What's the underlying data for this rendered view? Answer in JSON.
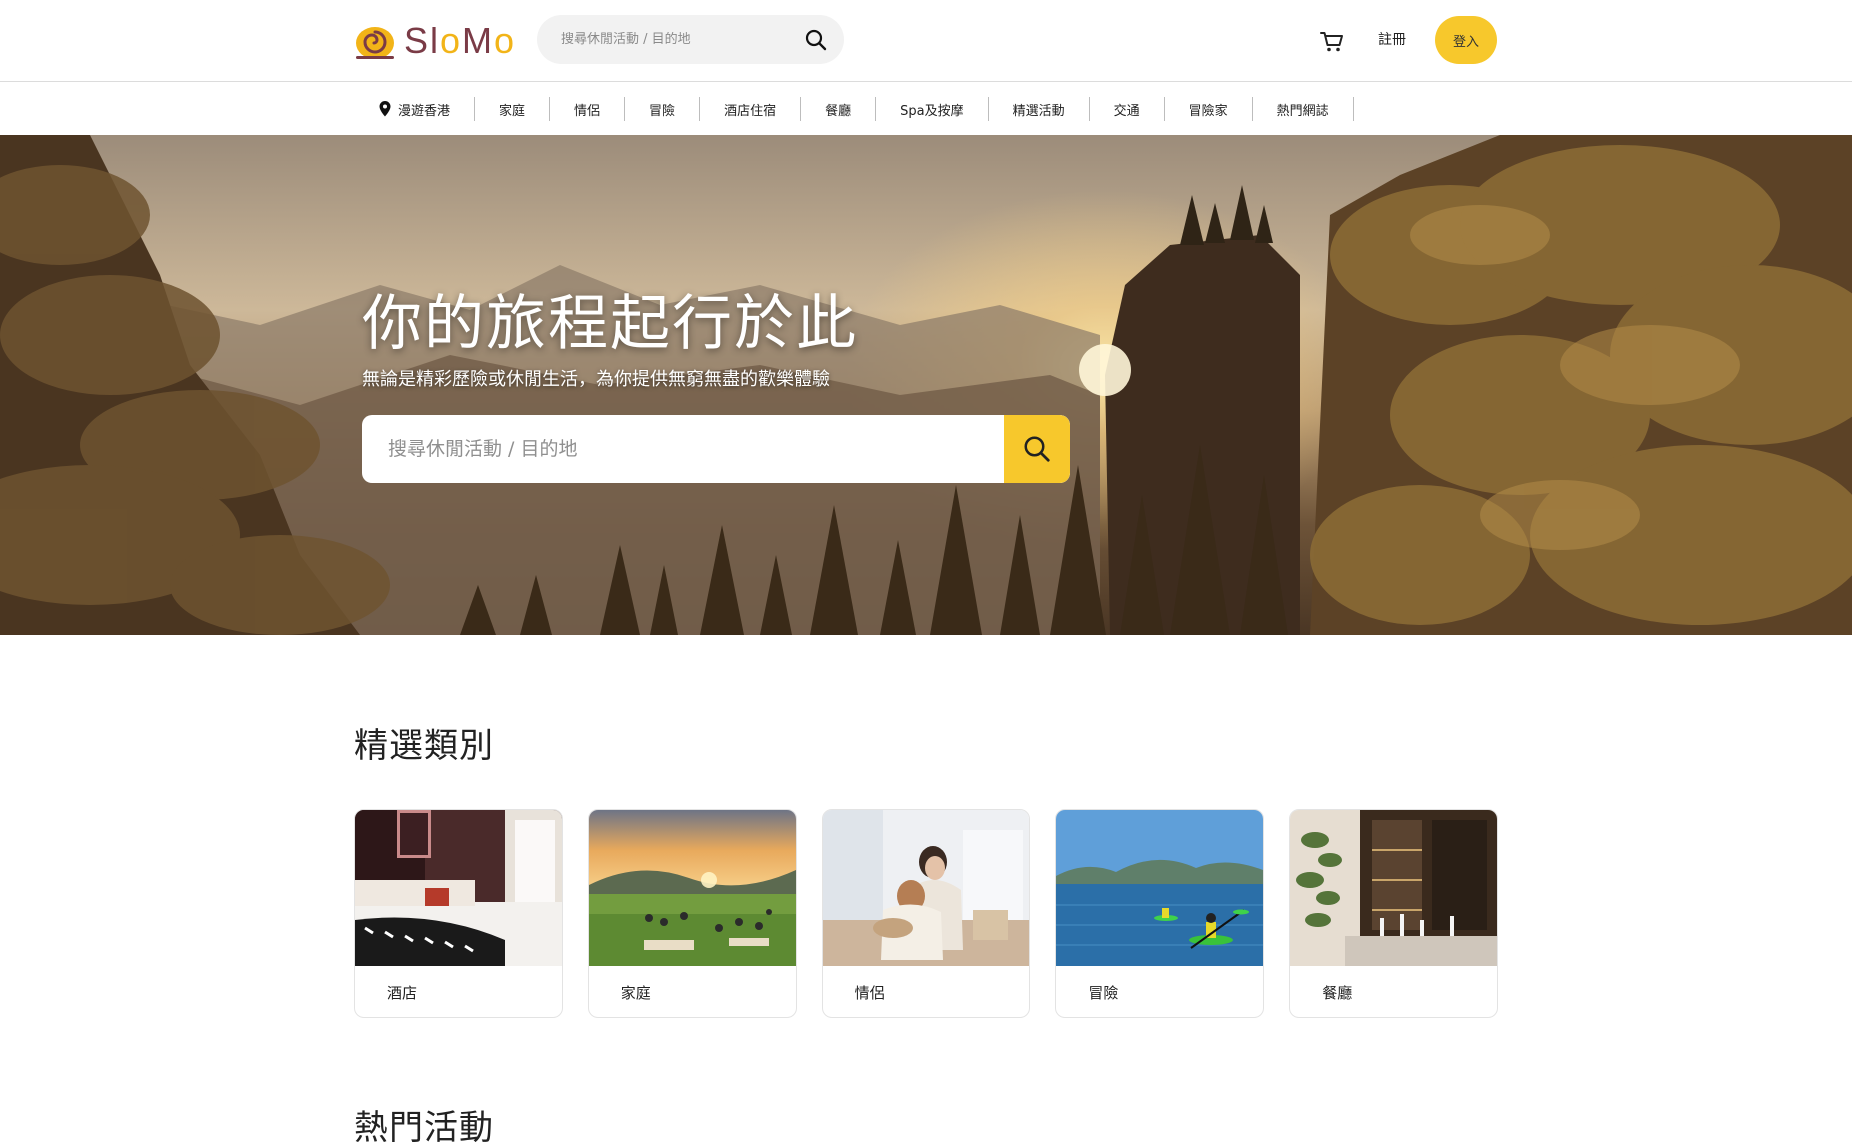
{
  "header": {
    "logo_text_1": "Sl",
    "logo_text_2": "o",
    "logo_text_3": "M",
    "logo_text_4": "o",
    "search_placeholder": "搜尋休閒活動 / 目的地",
    "register_label": "註冊",
    "login_label": "登入"
  },
  "nav": {
    "items": [
      {
        "label": "漫遊香港"
      },
      {
        "label": "家庭"
      },
      {
        "label": "情侶"
      },
      {
        "label": "冒險"
      },
      {
        "label": "酒店住宿"
      },
      {
        "label": "餐廳"
      },
      {
        "label": "Spa及按摩"
      },
      {
        "label": "精選活動"
      },
      {
        "label": "交通"
      },
      {
        "label": "冒險家"
      },
      {
        "label": "熱門網誌"
      }
    ]
  },
  "hero": {
    "title": "你的旅程起行於此",
    "subtitle": "無論是精彩歷險或休閒生活，為你提供無窮無盡的歡樂體驗",
    "search_placeholder": "搜尋休閒活動 / 目的地"
  },
  "featured": {
    "title": "精選類別",
    "cards": [
      {
        "label": "酒店"
      },
      {
        "label": "家庭"
      },
      {
        "label": "情侶"
      },
      {
        "label": "冒險"
      },
      {
        "label": "餐廳"
      }
    ]
  },
  "popular": {
    "title": "熱門活動"
  },
  "colors": {
    "accent": "#f7c82c",
    "logo_brown": "#7a3b46",
    "logo_yellow": "#f2b418"
  },
  "icons": [
    "snail-logo-icon",
    "search-icon",
    "cart-icon",
    "map-pin-icon"
  ]
}
